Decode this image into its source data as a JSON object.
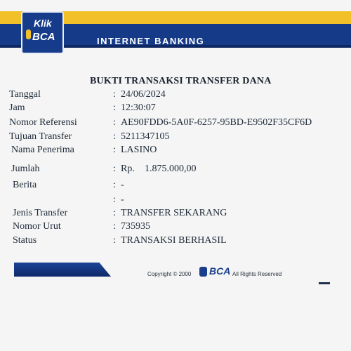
{
  "header": {
    "logo_top": "Klik",
    "logo_bottom": "BCA",
    "banner_title": "INTERNET BANKING",
    "colors": {
      "yellow": "#f2c12a",
      "blue": "#153a87"
    }
  },
  "receipt": {
    "title": "BUKTI TRANSAKSI TRANSFER DANA",
    "separator": ":",
    "rows": [
      {
        "label": "Tanggal",
        "value": "24/06/2024"
      },
      {
        "label": "Jam",
        "value": "12:30:07"
      },
      {
        "label": "Nomor Referensi",
        "value": "AE90FDD6-5A0F-6257-95BD-E9502F35CF6D"
      },
      {
        "label": "Tujuan Transfer",
        "value": "5211347105"
      },
      {
        "label": "Nama Penerima",
        "value": "LASINO"
      },
      {
        "label": "Jumlah",
        "currency": "Rp.",
        "value": "1.875.000,00"
      },
      {
        "label": "Berita",
        "value": "-"
      },
      {
        "label": "",
        "value": "-"
      },
      {
        "label": "Jenis Transfer",
        "value": "TRANSFER SEKARANG"
      },
      {
        "label": "Nomor Urut",
        "value": "735935"
      },
      {
        "label": "Status",
        "value": "TRANSAKSI BERHASIL"
      }
    ]
  },
  "footer": {
    "copyright": "Copyright © 2000",
    "logo": "BCA",
    "rights": "All Rights Reserved"
  }
}
